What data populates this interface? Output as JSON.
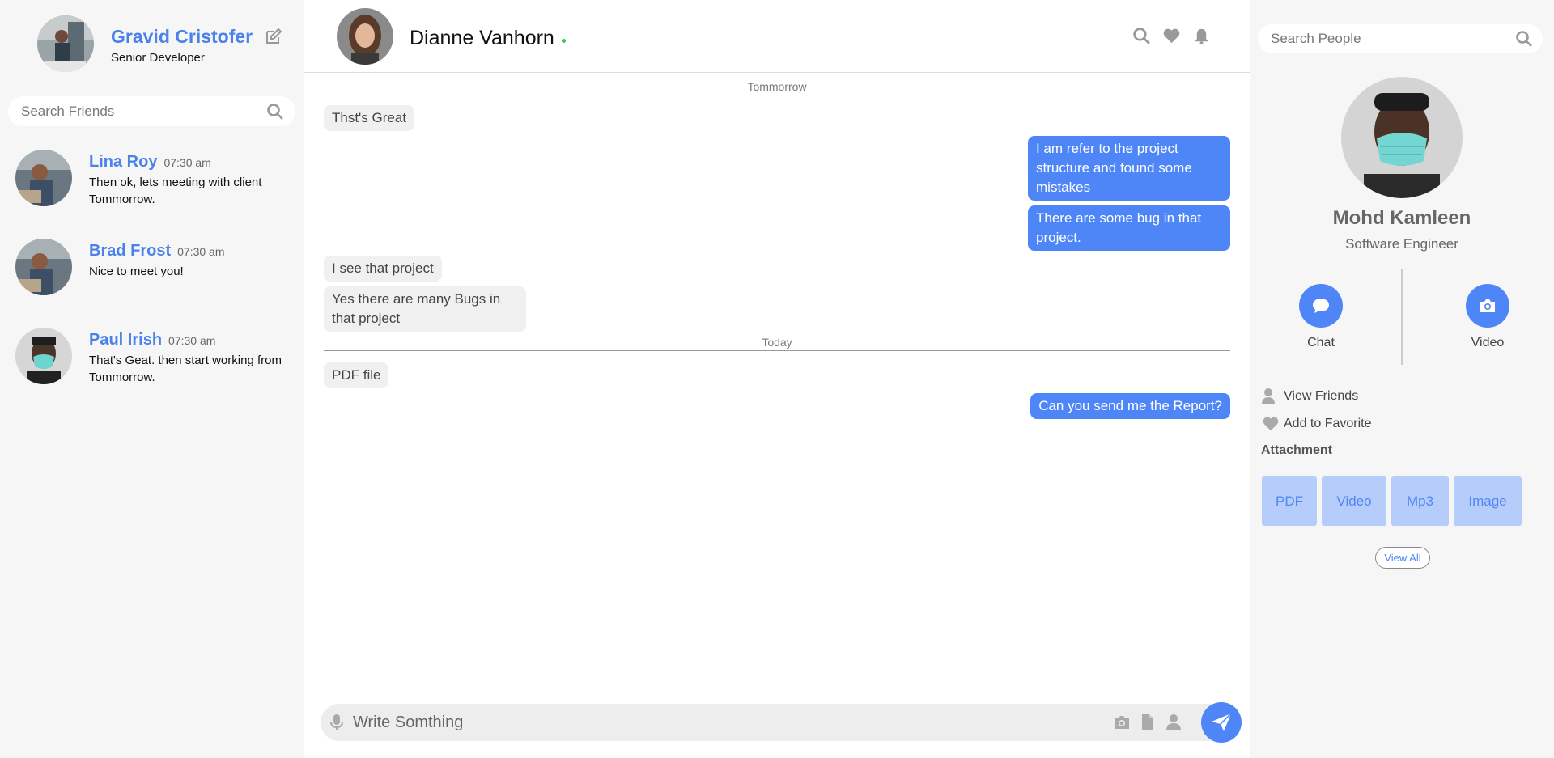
{
  "colors": {
    "accent": "#4f86f7",
    "name_blue": "#4a82ea",
    "online": "#2ecc40",
    "attachment_bg": "#b6cdfb"
  },
  "current_user": {
    "name": "Gravid Cristofer",
    "role": "Senior Developer",
    "edit_icon": "edit-icon"
  },
  "search_friends": {
    "placeholder": "Search Friends",
    "icon": "search-icon"
  },
  "friends": [
    {
      "name": "Lina Roy",
      "time": "07:30 am",
      "message": "Then ok, lets meeting with client Tommorrow."
    },
    {
      "name": "Brad Frost",
      "time": "07:30 am",
      "message": "Nice to meet you!"
    },
    {
      "name": "Paul Irish",
      "time": "07:30 am",
      "message": "That's Geat. then start working from Tommorrow."
    }
  ],
  "chat": {
    "contact_name": "Dianne Vanhorn",
    "header_icons": [
      "search-icon",
      "heart-icon",
      "bell-icon"
    ],
    "dividers": [
      "Tommorrow",
      "Today"
    ],
    "messages": [
      {
        "side": "in",
        "text": "Thst's Great"
      },
      {
        "side": "out",
        "text": "I am refer to the project structure and found some mistakes"
      },
      {
        "side": "out",
        "text": "There are some bug in that project."
      },
      {
        "side": "in",
        "text": "I see that project"
      },
      {
        "side": "in",
        "text": "Yes there are many Bugs in that project"
      },
      {
        "side": "in",
        "text": "PDF file"
      },
      {
        "side": "out",
        "text": "Can you send me the Report?"
      }
    ],
    "composer": {
      "placeholder": "Write Somthing",
      "icons": [
        "microphone-icon",
        "camera-icon",
        "file-icon",
        "user-icon",
        "send-icon"
      ]
    }
  },
  "search_people": {
    "placeholder": "Search People",
    "icon": "search-icon"
  },
  "profile": {
    "name": "Mohd Kamleen",
    "role": "Software Engineer",
    "actions": [
      {
        "label": "Chat",
        "icon": "chat-bubble-icon"
      },
      {
        "label": "Video",
        "icon": "camera-icon"
      }
    ],
    "links": [
      {
        "label": "View Friends",
        "icon": "user-icon"
      },
      {
        "label": "Add to Favorite",
        "icon": "heart-icon"
      }
    ],
    "attachment_title": "Attachment",
    "attachments": [
      "PDF",
      "Video",
      "Mp3",
      "Image"
    ],
    "view_all": "View All"
  }
}
